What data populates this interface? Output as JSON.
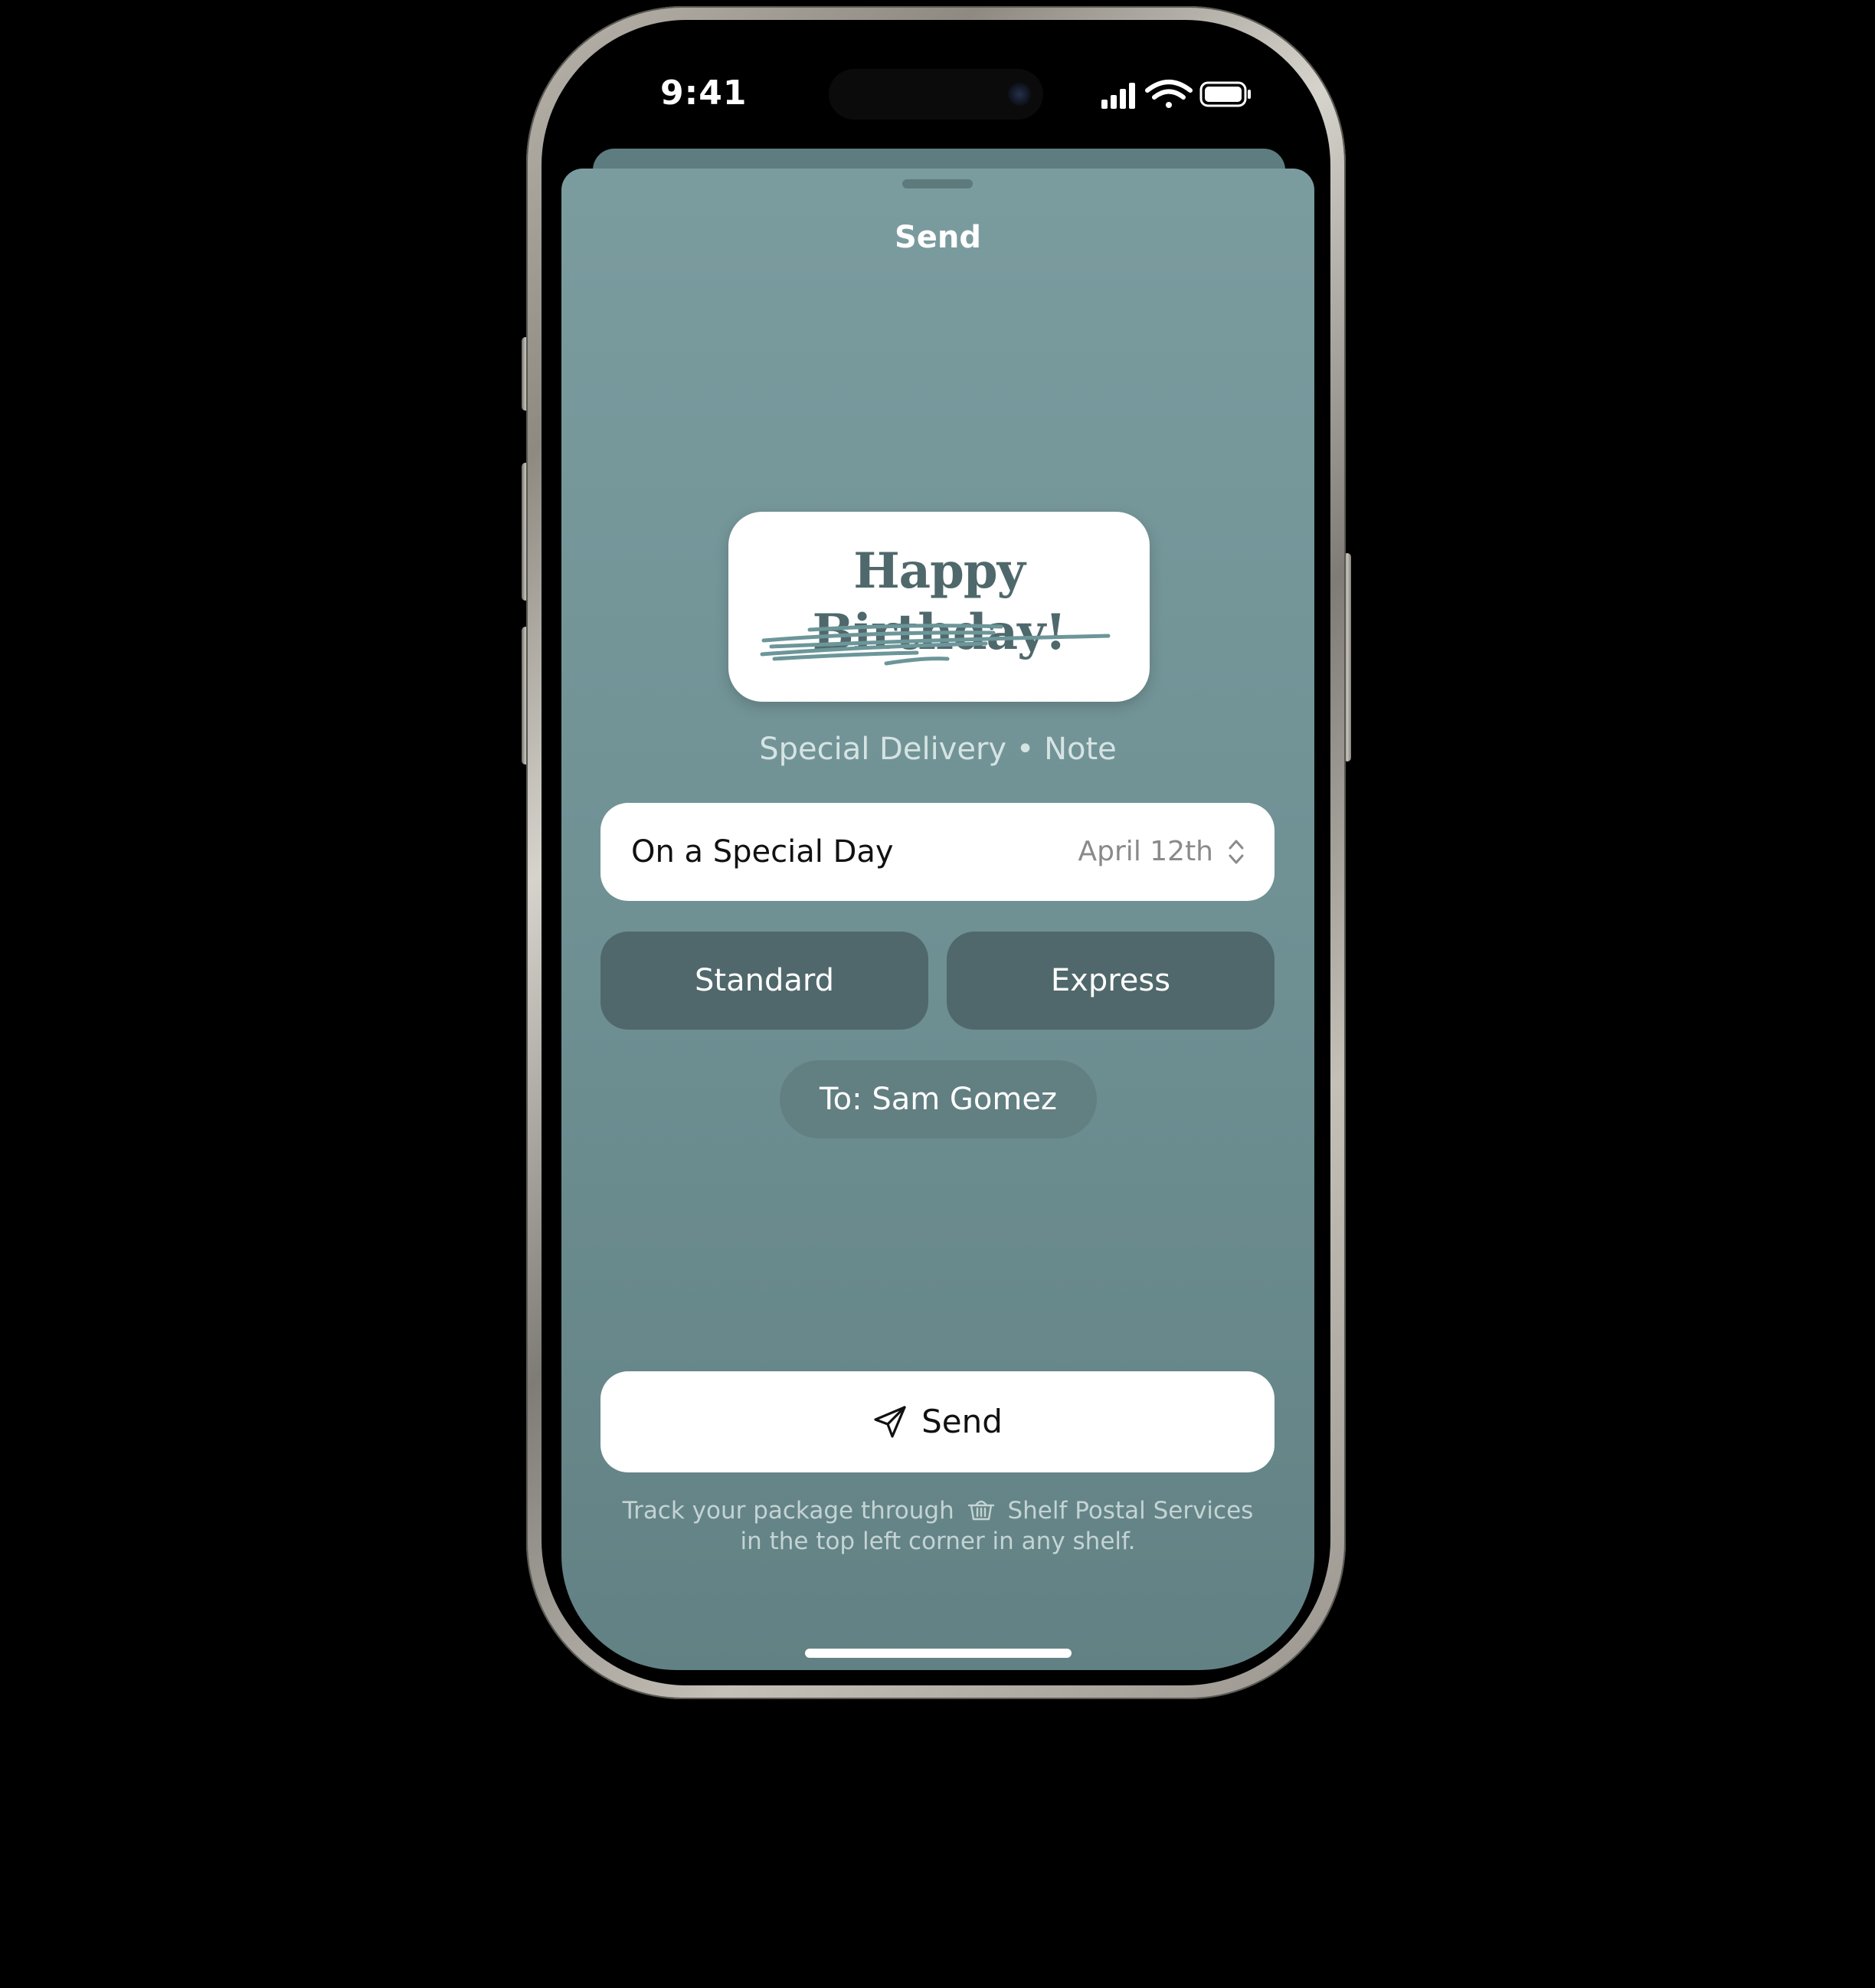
{
  "status_bar": {
    "time": "9:41",
    "icons": [
      "signal-icon",
      "wifi-icon",
      "battery-icon"
    ]
  },
  "sheet": {
    "title": "Send",
    "card": {
      "text": "Happy Birthday!"
    },
    "subtitle": "Special Delivery • Note",
    "delivery_date": {
      "label": "On a Special Day",
      "value": "April 12th"
    },
    "options": {
      "standard": "Standard",
      "express": "Express"
    },
    "recipient": "To: Sam Gomez",
    "send_label": "Send",
    "footnote": {
      "part1": "Track your package through",
      "service": "Shelf Postal Services",
      "part2": "in the top left corner in any shelf."
    }
  },
  "colors": {
    "sheet_top": "#7b9c9f",
    "sheet_bottom": "#628184",
    "option_button": "#50686b",
    "card_text": "#4f686b"
  }
}
